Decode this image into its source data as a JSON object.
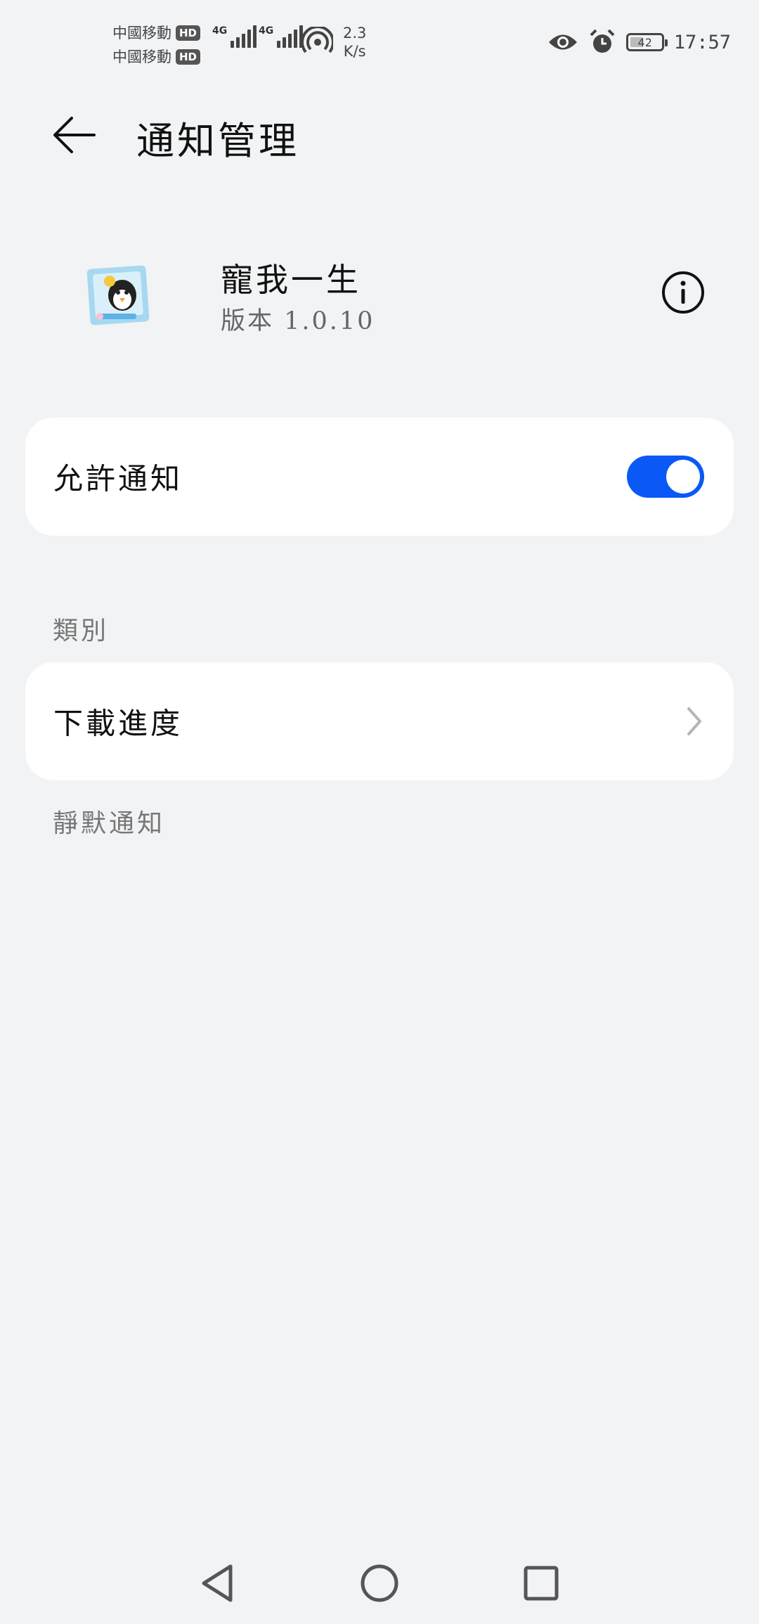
{
  "status_bar": {
    "carrier_1": "中國移動",
    "carrier_2": "中國移動",
    "hd_badge": "HD",
    "network_type": "4G",
    "net_speed_value": "2.3",
    "net_speed_unit": "K/s",
    "battery_level": "42",
    "time": "17:57"
  },
  "header": {
    "title": "通知管理"
  },
  "app": {
    "name": "寵我一生",
    "version": "版本 1.0.10"
  },
  "allow_notifications": {
    "label": "允許通知",
    "enabled": true
  },
  "categories": {
    "title": "類別",
    "items": [
      {
        "label": "下載進度"
      }
    ]
  },
  "silent": {
    "title": "靜默通知"
  },
  "colors": {
    "accent": "#0a59f7",
    "background": "#f1f3f5",
    "card": "#ffffff"
  }
}
